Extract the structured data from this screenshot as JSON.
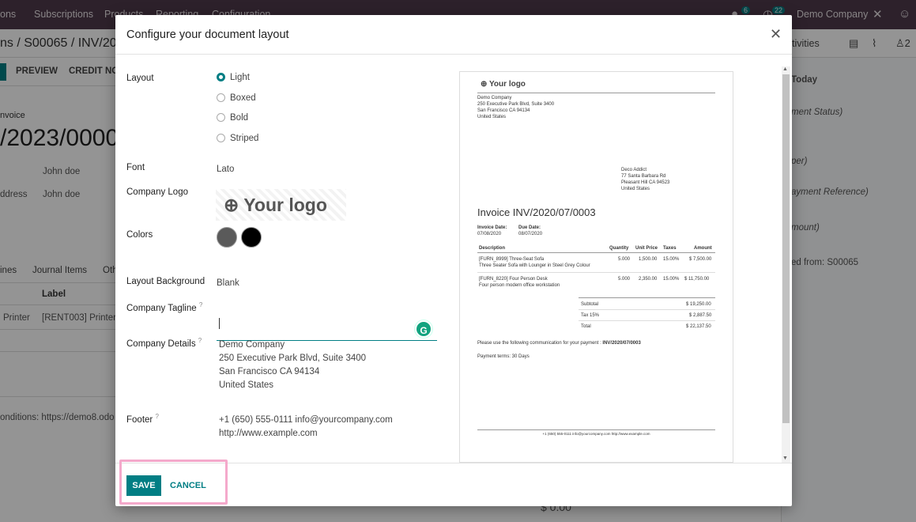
{
  "topbar": {
    "app_partial": "ons",
    "menus": [
      "Subscriptions",
      "Products",
      "Reporting",
      "Configuration"
    ],
    "chat_count": "6",
    "activity_count": "22",
    "company": "Demo Company"
  },
  "breadcrumb": "ns / S00065 / INV/202",
  "actions": {
    "preview": "PREVIEW",
    "credit_note": "CREDIT NO",
    "activities": "tivities",
    "followers_count": "2"
  },
  "background": {
    "invoice_label": "nvoice",
    "invoice_number": "/2023/00005",
    "customer": "John doe",
    "address_label": "ddress",
    "address_value": "John doe",
    "tabs": [
      "ines",
      "Journal Items",
      "Oth"
    ],
    "col_label": "Label",
    "row_left": "Printer",
    "row_label": "[RENT003] Printer",
    "conditions": "onditions: https://demo8.odo",
    "amount": "$ 0.00",
    "chatter": {
      "today": "Today",
      "payment_status": "ment Status)",
      "per": "per)",
      "payment_reference": "ayment Reference)",
      "amount": "mount)",
      "created_from": "ed from: S00065"
    }
  },
  "dialog": {
    "title": "Configure your document layout",
    "labels": {
      "layout": "Layout",
      "font": "Font",
      "company_logo": "Company Logo",
      "colors": "Colors",
      "layout_background": "Layout Background",
      "company_tagline": "Company Tagline",
      "company_details": "Company Details",
      "footer": "Footer"
    },
    "layout_options": [
      "Light",
      "Boxed",
      "Bold",
      "Striped"
    ],
    "layout_selected": "Light",
    "font": "Lato",
    "logo_placeholder": "Your logo",
    "colors": [
      "#5a5a5a",
      "#000000"
    ],
    "layout_background": "Blank",
    "tagline": "",
    "company_details": [
      "Demo Company",
      "250 Executive Park Blvd, Suite 3400",
      "San Francisco CA 94134",
      "United States"
    ],
    "footer": [
      "+1 (650) 555-0111 info@yourcompany.com",
      "http://www.example.com"
    ],
    "save_label": "SAVE",
    "cancel_label": "CANCEL"
  },
  "preview": {
    "logo": "Your logo",
    "company": [
      "Demo Company",
      "250 Executive Park Blvd, Suite 3400",
      "San Francisco CA 94134",
      "United States"
    ],
    "customer": [
      "Deco Addict",
      "77 Santa Barbara Rd",
      "Pleasant Hill CA 94523",
      "United States"
    ],
    "title": "Invoice INV/2020/07/0003",
    "invoice_date_label": "Invoice Date:",
    "invoice_date": "07/08/2020",
    "due_date_label": "Due Date:",
    "due_date": "08/07/2020",
    "columns": [
      "Description",
      "Quantity",
      "Unit Price",
      "Taxes",
      "Amount"
    ],
    "lines": [
      {
        "desc": "[FURN_8999] Three-Seat Sofa",
        "desc2": "Three Seater Sofa with Lounger in Steel Grey Colour",
        "qty": "5.000",
        "price": "1,500.00",
        "tax": "15.00%",
        "amount": "$ 7,500.00"
      },
      {
        "desc": "[FURN_8220] Four Person Desk",
        "desc2": "Four person modern office workstation",
        "qty": "5.000",
        "price": "2,350.00",
        "tax": "15.00%",
        "amount": "$ 11,750.00"
      }
    ],
    "subtotal_label": "Subtotal",
    "subtotal": "$ 19,250.00",
    "tax_label": "Tax 15%",
    "tax": "$ 2,887.50",
    "total_label": "Total",
    "total": "$ 22,137.50",
    "communication": "Please use the following communication for your payment : ",
    "communication_ref": "INV/2020/07/0003",
    "payment_terms": "Payment terms: 30 Days",
    "footer": "+1 (650) 555-0111 info@yourcompany.com http://www.example.com"
  }
}
